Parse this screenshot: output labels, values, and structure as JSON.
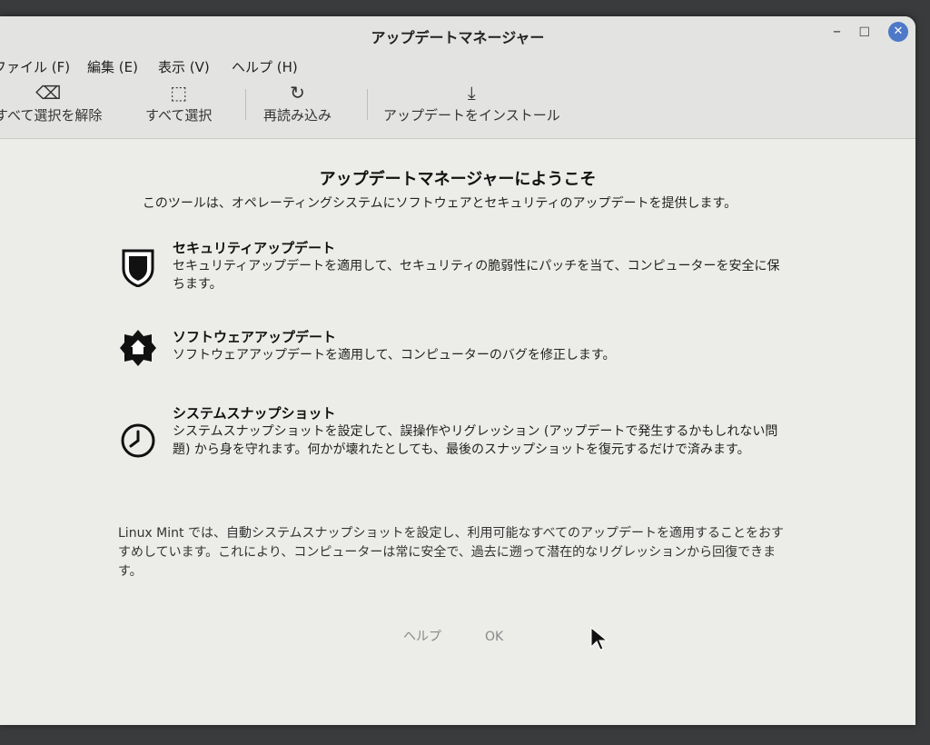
{
  "window": {
    "title": "アップデートマネージャー"
  },
  "menubar": [
    "ファイル (F)",
    "編集 (E)",
    "表示 (V)",
    "ヘルプ (H)"
  ],
  "toolbar": {
    "clear_selection": "すべて選択を解除",
    "select_all": "すべて選択",
    "refresh": "再読み込み",
    "install": "アップデートをインストール"
  },
  "main": {
    "heading": "アップデートマネージャーにようこそ",
    "subheading": "このツールは、オペレーティングシステムにソフトウェアとセキュリティのアップデートを提供します。",
    "features": [
      {
        "title": "セキュリティアップデート",
        "description": "セキュリティアップデートを適用して、セキュリティの脆弱性にパッチを当て、コンピューターを安全に保ちます。",
        "icon": "shield-icon"
      },
      {
        "title": "ソフトウェアアップデート",
        "description": "ソフトウェアアップデートを適用して、コンピューターのバグを修正します。",
        "icon": "gear-icon"
      },
      {
        "title": "システムスナップショット",
        "description": "システムスナップショットを設定して、誤操作やリグレッション (アップデートで発生するかもしれない問題) から身を守れます。何かが壊れたとしても、最後のスナップショットを復元するだけで済みます。",
        "icon": "clock-icon"
      }
    ],
    "note": "Linux Mint では、自動システムスナップショットを設定し、利用可能なすべてのアップデートを適用することをおすすめしています。これにより、コンピューターは常に安全で、過去に遡って潜在的なリグレッションから回復できます。"
  },
  "buttons": {
    "help": "ヘルプ",
    "ok": "OK"
  }
}
